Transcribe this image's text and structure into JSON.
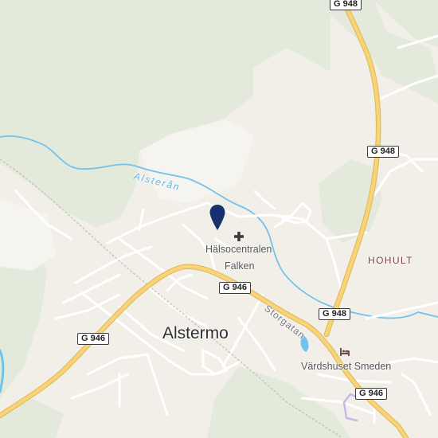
{
  "map": {
    "places": {
      "town": "Alstermo",
      "locality": "HOHULT",
      "poi_health_line1": "Hälsocentralen",
      "poi_health_line2": "Falken",
      "poi_inn": "Värdshuset Smeden"
    },
    "roads": {
      "storgatan": "Storgatan",
      "shields": [
        "G 948",
        "G 948",
        "G 948",
        "G 946",
        "G 946",
        "G 946"
      ]
    },
    "water": {
      "river": "Alsterån"
    },
    "icons": [
      "location-pin-icon",
      "hospital-cross-icon",
      "hotel-bed-icon"
    ],
    "colors": {
      "background": "#f2efe9",
      "forest": "#e5ebdb",
      "water": "#72c2eb",
      "major_road": "#f7d479",
      "minor_road": "#ffffff",
      "pin": "#17306e"
    }
  }
}
